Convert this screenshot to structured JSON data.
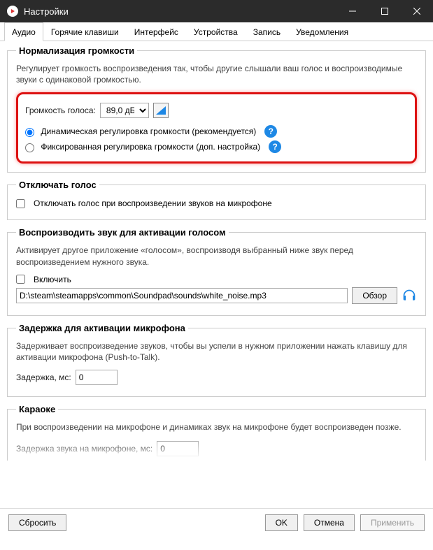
{
  "window": {
    "title": "Настройки"
  },
  "tabs": [
    "Аудио",
    "Горячие клавиши",
    "Интерфейс",
    "Устройства",
    "Запись",
    "Уведомления"
  ],
  "norm": {
    "legend": "Нормализация громкости",
    "desc": "Регулирует громкость воспроизведения так, чтобы другие слышали ваш голос и воспроизводимые звуки с одинаковой громкостью.",
    "voice_label": "Громкость голоса:",
    "voice_value": "89,0 дБ",
    "opt_dynamic": "Динамическая регулировка громкости (рекомендуется)",
    "opt_fixed": "Фиксированная регулировка громкости (доп. настройка)"
  },
  "mute": {
    "legend": "Отключать голос",
    "checkbox": "Отключать голос при воспроизведении звуков на микрофоне"
  },
  "voiceact": {
    "legend": "Воспроизводить звук для активации голосом",
    "desc": "Активирует другое приложение «голосом», воспроизводя выбранный ниже звук перед воспроизведением нужного звука.",
    "enable": "Включить",
    "path": "D:\\steam\\steamapps\\common\\Soundpad\\sounds\\white_noise.mp3",
    "browse": "Обзор"
  },
  "micdelay": {
    "legend": "Задержка для активации микрофона",
    "desc": "Задерживает воспроизведение звуков, чтобы вы успели в нужном приложении нажать клавишу для активации микрофона (Push-to-Talk).",
    "label": "Задержка, мс:",
    "value": "0"
  },
  "karaoke": {
    "legend": "Караоке",
    "desc": "При воспроизведении на микрофоне и динамиках звук на микрофоне будет воспроизведен позже.",
    "label": "Задержка звука на микрофоне, мс:",
    "value": "0"
  },
  "buttons": {
    "reset": "Сбросить",
    "ok": "OK",
    "cancel": "Отмена",
    "apply": "Применить"
  }
}
